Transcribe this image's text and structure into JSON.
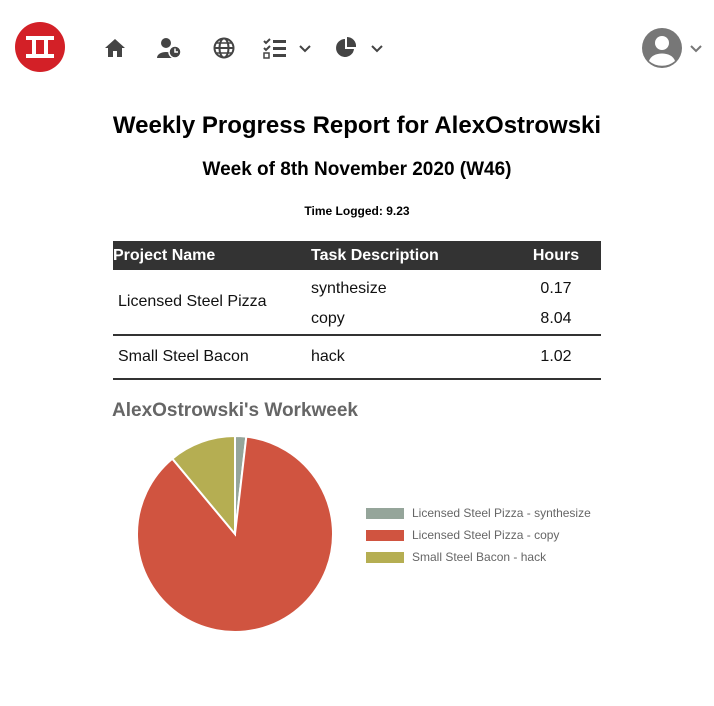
{
  "nav": {
    "icons": [
      "home-icon",
      "user-clock-icon",
      "globe-icon",
      "tasks-icon",
      "pie-chart-icon"
    ],
    "dropdown_icons": [
      "chevron-down-icon"
    ]
  },
  "report": {
    "title": "Weekly Progress Report for AlexOstrowski",
    "week": "Week of 8th November 2020 (W46)",
    "time_logged": "Time Logged: 9.23"
  },
  "table": {
    "headers": [
      "Project Name",
      "Task Description",
      "Hours"
    ],
    "projects": [
      {
        "name": "Licensed Steel Pizza",
        "tasks": [
          {
            "task": "synthesize",
            "hours": "0.17"
          },
          {
            "task": "copy",
            "hours": "8.04"
          }
        ]
      },
      {
        "name": "Small Steel Bacon",
        "tasks": [
          {
            "task": "hack",
            "hours": "1.02"
          }
        ]
      }
    ]
  },
  "chart_data": {
    "type": "pie",
    "title": "AlexOstrowski's Workweek",
    "slices": [
      {
        "label": "Licensed Steel Pizza - synthesize",
        "value": 0.17,
        "color": "#95a59a"
      },
      {
        "label": "Licensed Steel Pizza - copy",
        "value": 8.04,
        "color": "#d05440"
      },
      {
        "label": "Small Steel Bacon - hack",
        "value": 1.02,
        "color": "#b5ae52"
      }
    ],
    "legend_position": "right"
  },
  "colors": {
    "logo": "#d32027",
    "header_bg": "#333333",
    "nav_icon": "#444444"
  }
}
